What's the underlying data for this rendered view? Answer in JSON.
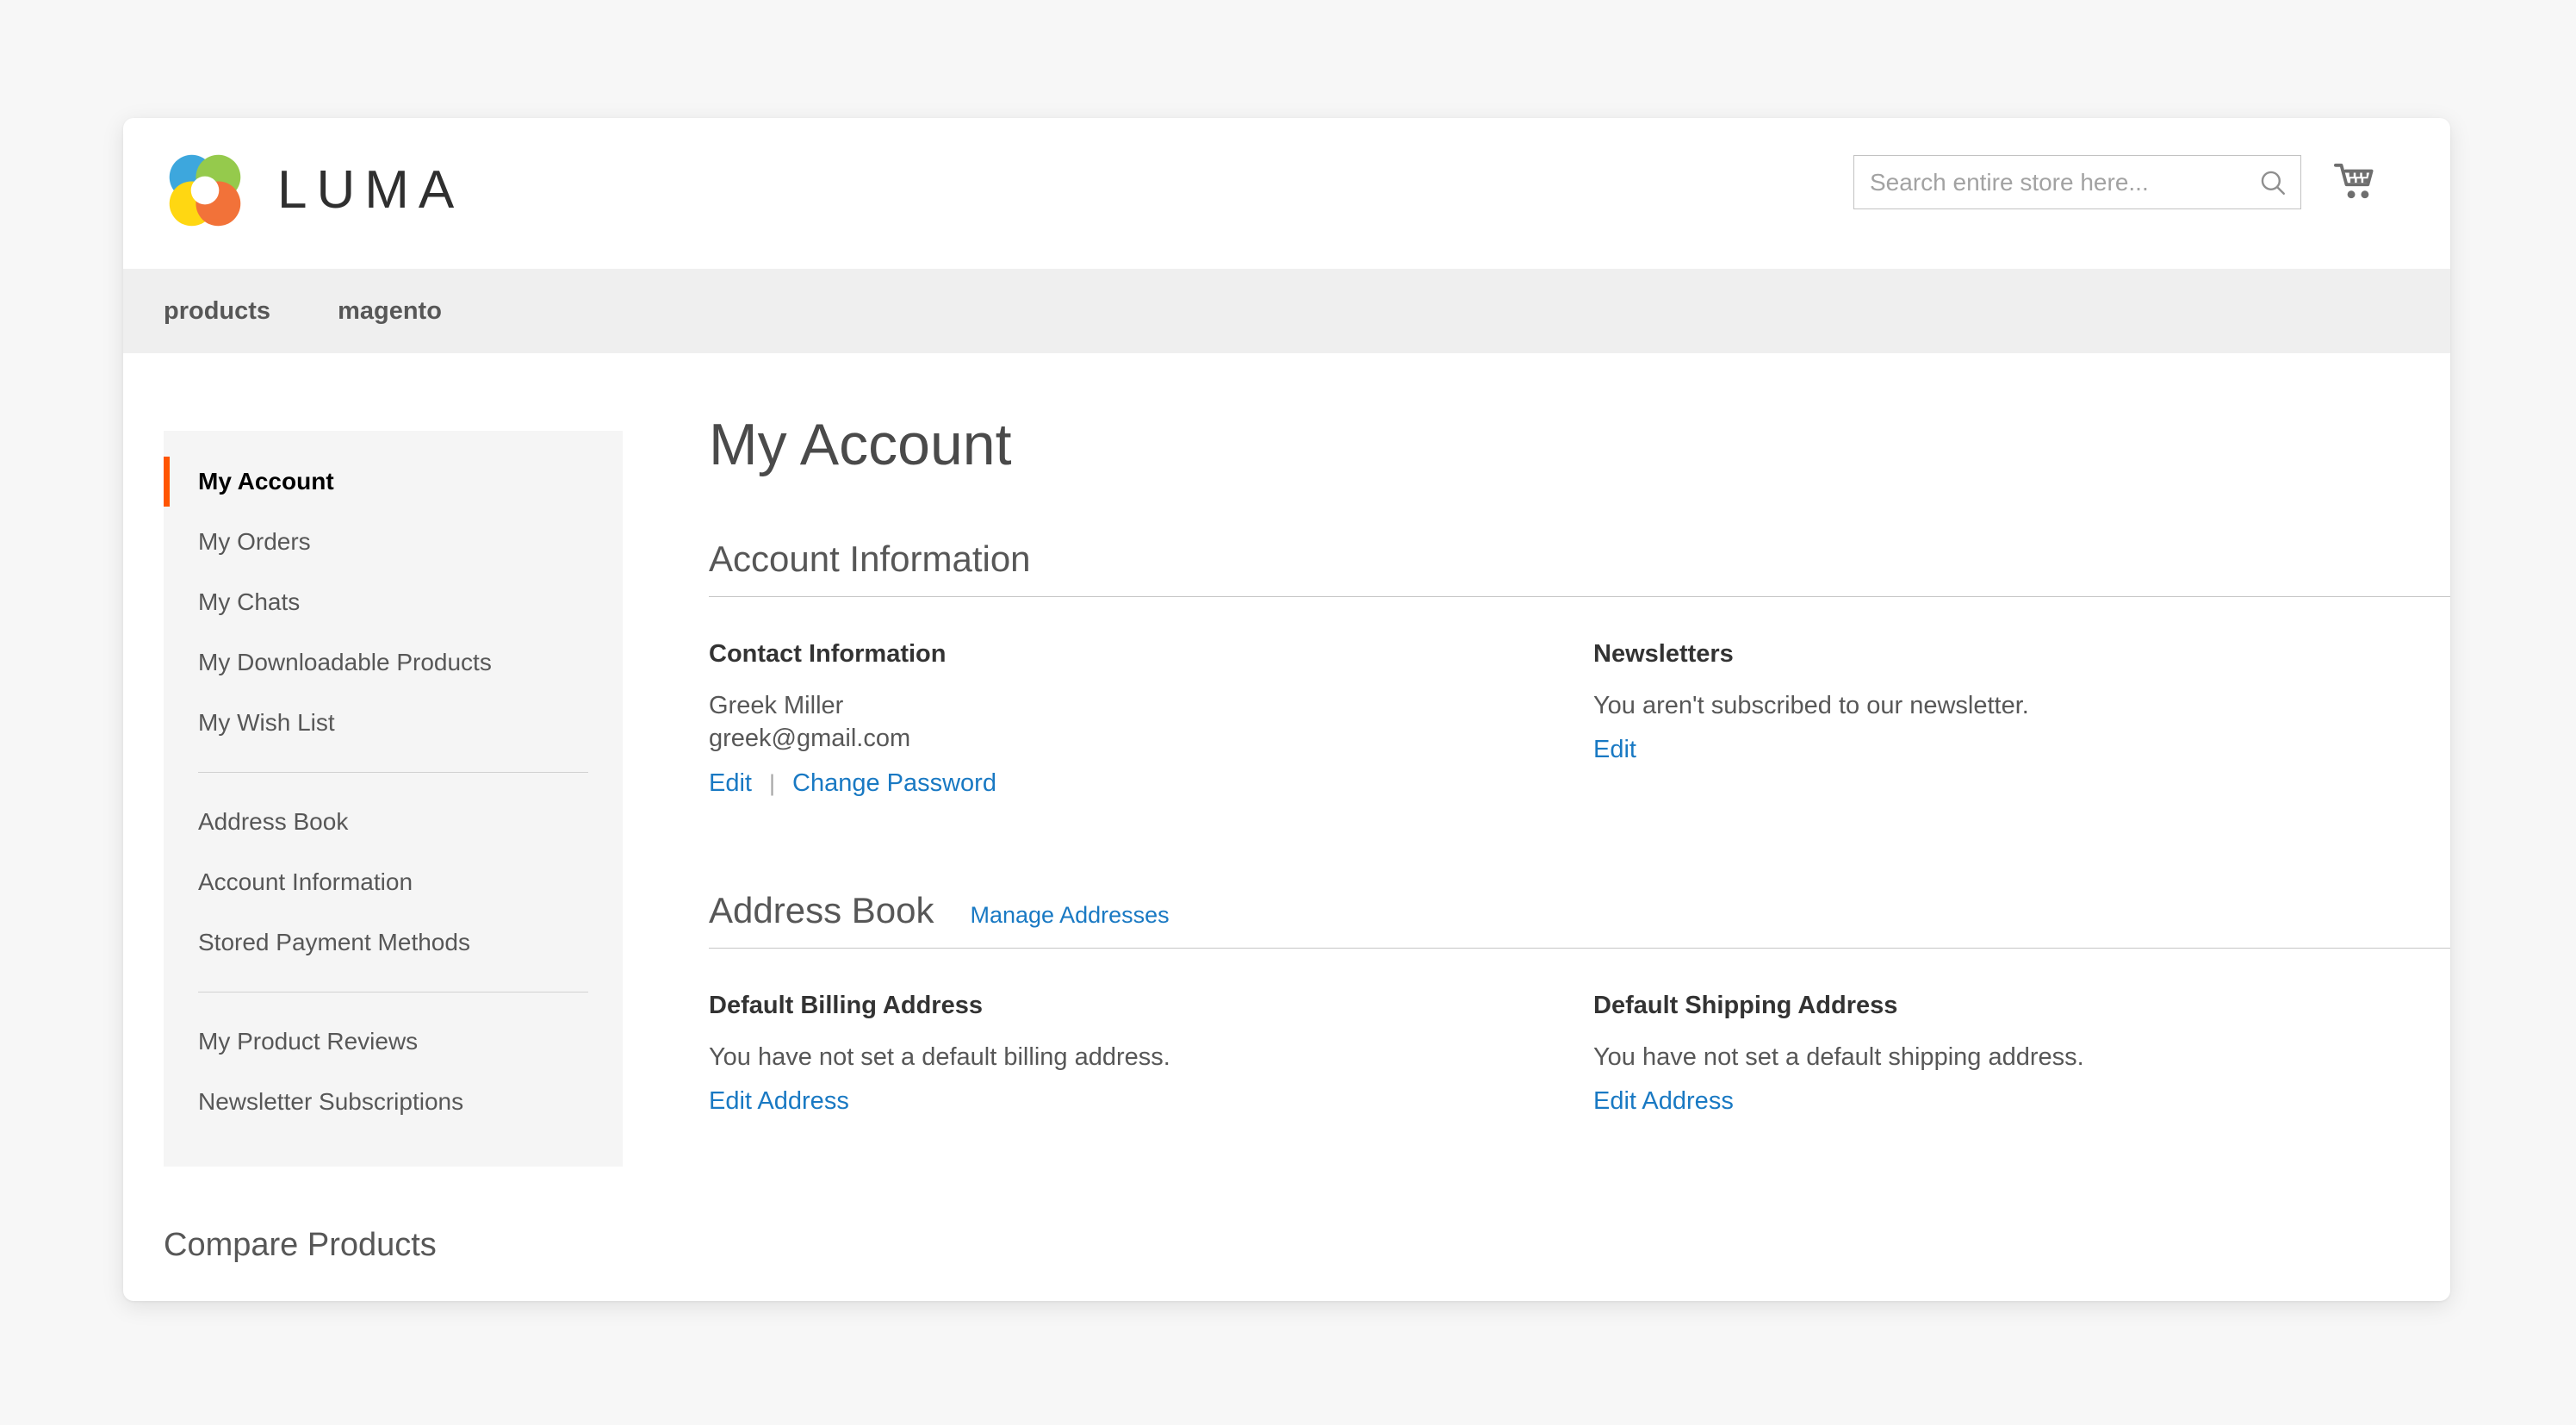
{
  "header": {
    "logo_text": "LUMA",
    "logo_icon": "luma-flower-logo",
    "search": {
      "placeholder": "Search entire store here...",
      "value": "",
      "icon": "search-icon"
    },
    "cart_icon": "shopping-cart-icon"
  },
  "nav": {
    "items": [
      {
        "label": "products"
      },
      {
        "label": "magento"
      }
    ]
  },
  "sidebar": {
    "groups": [
      {
        "items": [
          {
            "label": "My Account",
            "active": true
          },
          {
            "label": "My Orders",
            "active": false
          },
          {
            "label": "My Chats",
            "active": false
          },
          {
            "label": "My Downloadable Products",
            "active": false
          },
          {
            "label": "My Wish List",
            "active": false
          }
        ]
      },
      {
        "items": [
          {
            "label": "Address Book",
            "active": false
          },
          {
            "label": "Account Information",
            "active": false
          },
          {
            "label": "Stored Payment Methods",
            "active": false
          }
        ]
      },
      {
        "items": [
          {
            "label": "My Product Reviews",
            "active": false
          },
          {
            "label": "Newsletter Subscriptions",
            "active": false
          }
        ]
      }
    ],
    "compare_products_title": "Compare Products"
  },
  "main": {
    "page_title": "My Account",
    "account_information": {
      "section_title": "Account Information",
      "contact": {
        "title": "Contact Information",
        "name": "Greek Miller",
        "email": "greek@gmail.com",
        "edit_label": "Edit",
        "separator": "|",
        "change_password_label": "Change Password"
      },
      "newsletters": {
        "title": "Newsletters",
        "status": "You aren't subscribed to our newsletter.",
        "edit_label": "Edit"
      }
    },
    "address_book": {
      "section_title": "Address Book",
      "manage_link": "Manage Addresses",
      "billing": {
        "title": "Default Billing Address",
        "status": "You have not set a default billing address.",
        "edit_label": "Edit Address"
      },
      "shipping": {
        "title": "Default Shipping Address",
        "status": "You have not set a default shipping address.",
        "edit_label": "Edit Address"
      }
    }
  },
  "colors": {
    "accent_orange": "#ff5501",
    "link_blue": "#1979c3",
    "nav_bg": "#efefef",
    "sidebar_bg": "#f5f5f5",
    "page_bg": "#f7f7f7"
  }
}
